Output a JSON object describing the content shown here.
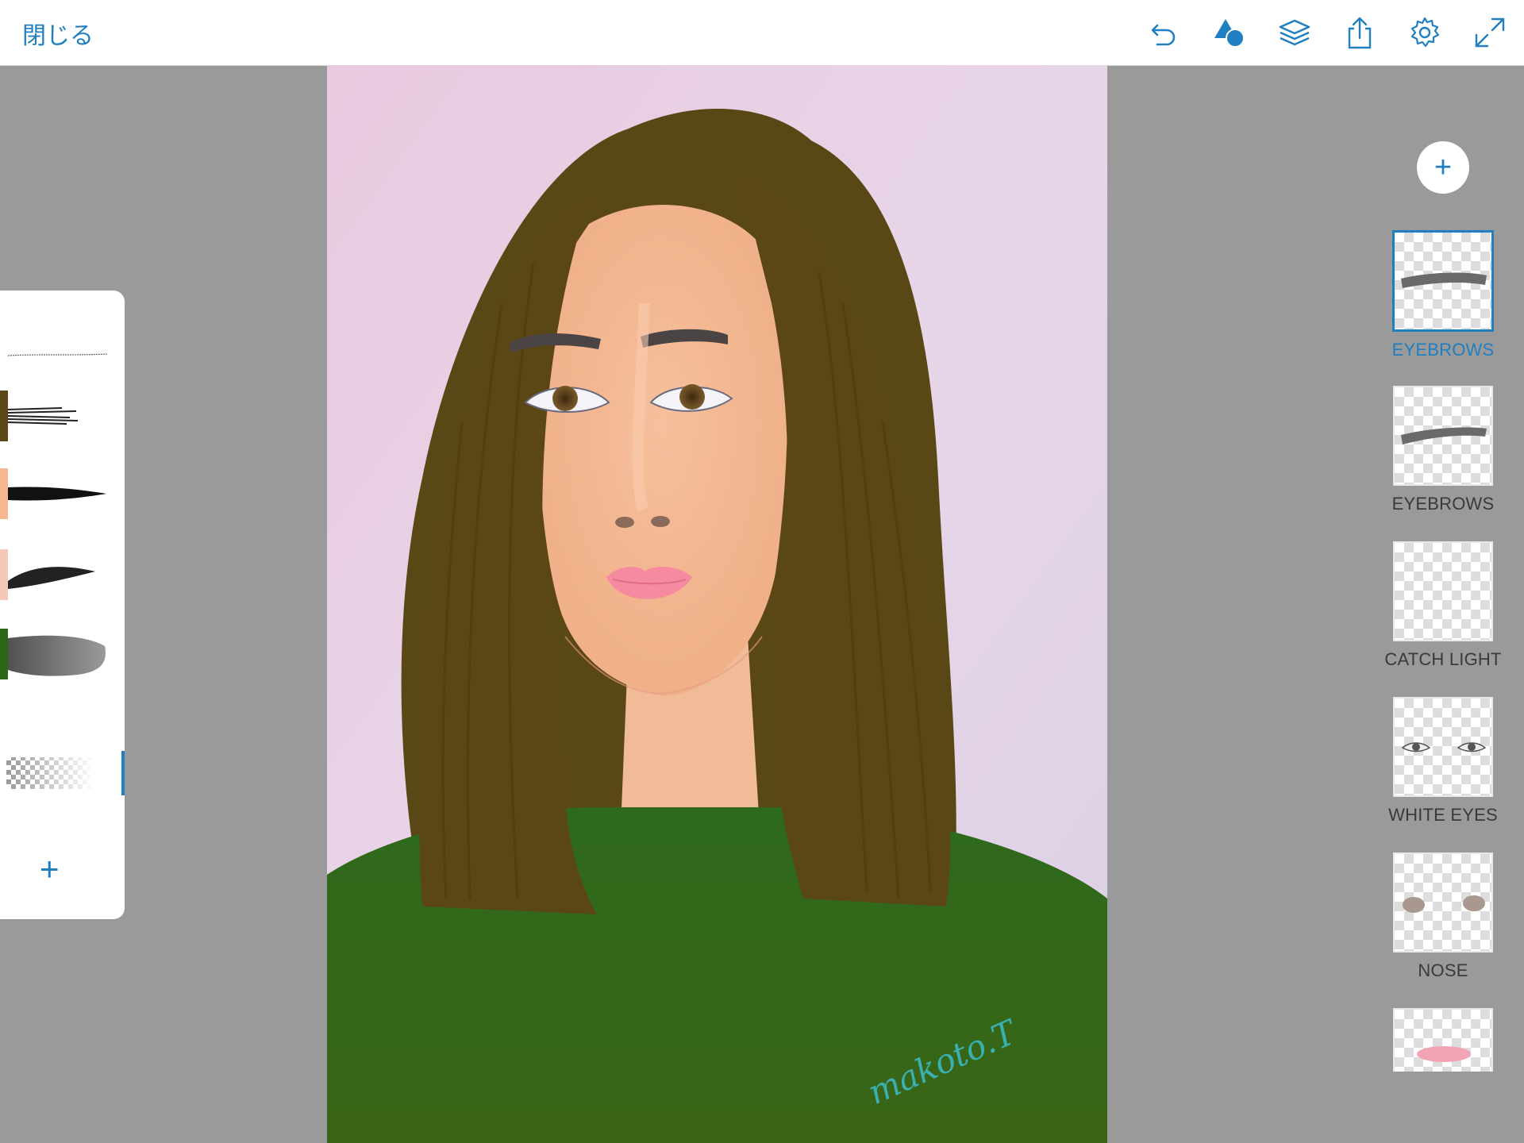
{
  "header": {
    "close_label": "閉じる",
    "tools": [
      {
        "name": "undo",
        "icon": "undo-icon"
      },
      {
        "name": "shapes",
        "icon": "shapes-icon"
      },
      {
        "name": "layers",
        "icon": "layers-icon"
      },
      {
        "name": "share",
        "icon": "share-icon"
      },
      {
        "name": "settings",
        "icon": "gear-icon"
      },
      {
        "name": "fullscreen",
        "icon": "expand-icon"
      }
    ]
  },
  "canvas": {
    "signature": "makoto.T",
    "colors": {
      "background": "#e6cfe3",
      "hair": "#5b4716",
      "skin": "#f4b890",
      "sweater": "#2f6518",
      "lips": "#f58aa0",
      "eyebrows": "#4a4444",
      "signature": "#3ab0b0"
    }
  },
  "brushes": {
    "add_label": "+",
    "items": [
      {
        "name": "fine-line",
        "color": "#ffffff"
      },
      {
        "name": "dry-brush",
        "color": "#5b4716"
      },
      {
        "name": "tapered-pen",
        "color": "#f4b890"
      },
      {
        "name": "charcoal",
        "color": "#f5c9b8"
      },
      {
        "name": "watercolor",
        "color": "#2f6518"
      },
      {
        "name": "eraser",
        "color": "#ffffff",
        "active": true
      }
    ]
  },
  "layers": {
    "add_label": "+",
    "items": [
      {
        "label": "EYEBROWS",
        "active": true
      },
      {
        "label": "EYEBROWS",
        "active": false
      },
      {
        "label": "CATCH LIGHT",
        "active": false
      },
      {
        "label": "WHITE EYES",
        "active": false
      },
      {
        "label": "NOSE",
        "active": false
      }
    ]
  },
  "accent": "#1f7fc0"
}
